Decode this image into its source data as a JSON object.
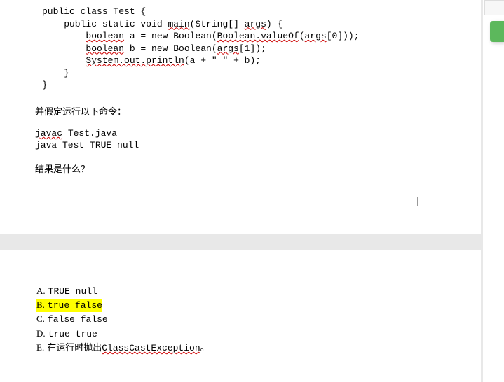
{
  "code": {
    "line1_a": "public class Test {",
    "line2_a": "    public static void ",
    "line2_main": "main",
    "line2_b": "(String[] ",
    "line2_args": "args",
    "line2_c": ") {",
    "line3_a": "        ",
    "line3_bool": "boolean",
    "line3_b": " a = new Boolean(",
    "line3_valof": "Boolean.valueOf",
    "line3_c": "(",
    "line3_args0": "args",
    "line3_d": "[0]));",
    "line4_a": "        ",
    "line4_bool": "boolean",
    "line4_b": " b = new Boolean(",
    "line4_args1": "args",
    "line4_c": "[1]);",
    "line5_a": "        ",
    "line5_sop": "System.out.println",
    "line5_b": "(a + \" \" + b);",
    "line6": "    }",
    "line7": "}"
  },
  "assume_text": "并假定运行以下命令：",
  "cmd": {
    "l1a": "javac",
    "l1b": " Test.java",
    "l2a": "java Test TRUE null"
  },
  "question": "结果是什么？",
  "answers": {
    "a_label": "A.",
    "a_text": "TRUE null",
    "b_label": "B.",
    "b_text": "true false",
    "c_label": "C.",
    "c_text": "false false",
    "d_label": "D.",
    "d_text": "true true",
    "e_label": "E.",
    "e_text_cn": "在运行时抛出 ",
    "e_text_code": "ClassCastException",
    "e_text_end": "。"
  }
}
